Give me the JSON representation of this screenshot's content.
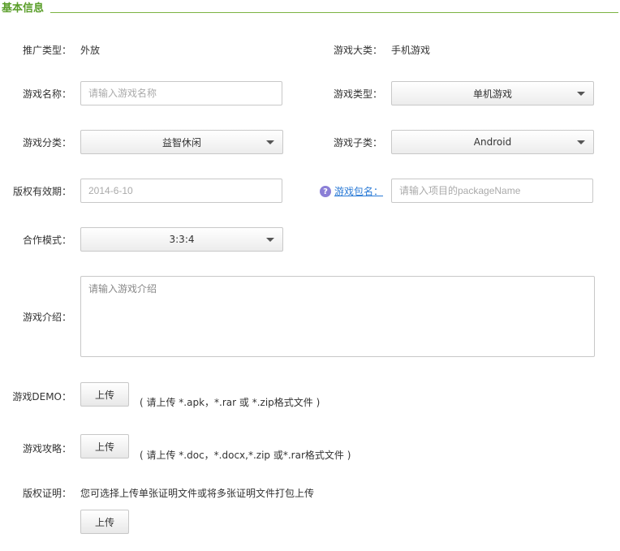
{
  "section": {
    "title": "基本信息"
  },
  "form": {
    "promo_type": {
      "label": "推广类型：",
      "value": "外放"
    },
    "game_category": {
      "label": "游戏大类：",
      "value": "手机游戏"
    },
    "game_name": {
      "label": "游戏名称：",
      "placeholder": "请输入游戏名称"
    },
    "game_type": {
      "label": "游戏类型：",
      "value": "单机游戏"
    },
    "game_class": {
      "label": "游戏分类：",
      "value": "益智休闲"
    },
    "game_subclass": {
      "label": "游戏子类：",
      "value": "Android"
    },
    "copyright_expiry": {
      "label": "版权有效期：",
      "placeholder": "2014-6-10"
    },
    "package_name": {
      "label": "游戏包名：",
      "placeholder": "请输入项目的packageName",
      "help_icon": "question-icon"
    },
    "coop_mode": {
      "label": "合作模式：",
      "value": "3:3:4"
    },
    "intro": {
      "label": "游戏介绍：",
      "placeholder": "请输入游戏介绍"
    },
    "demo": {
      "label": "游戏DEMO：",
      "button": "上传",
      "hint": "( 请上传 *.apk，*.rar 或 *.zip格式文件 )"
    },
    "guide": {
      "label": "游戏攻略：",
      "button": "上传",
      "hint": "( 请上传 *.doc，*.docx,*.zip 或*.rar格式文件 )"
    },
    "copyright_proof": {
      "label": "版权证明：",
      "note": "您可选择上传单张证明文件或将多张证明文件打包上传",
      "button": "上传"
    }
  },
  "colors": {
    "accent": "#5a9e2a",
    "link": "#2a7ad6",
    "help_icon": "#8b7fd6"
  }
}
